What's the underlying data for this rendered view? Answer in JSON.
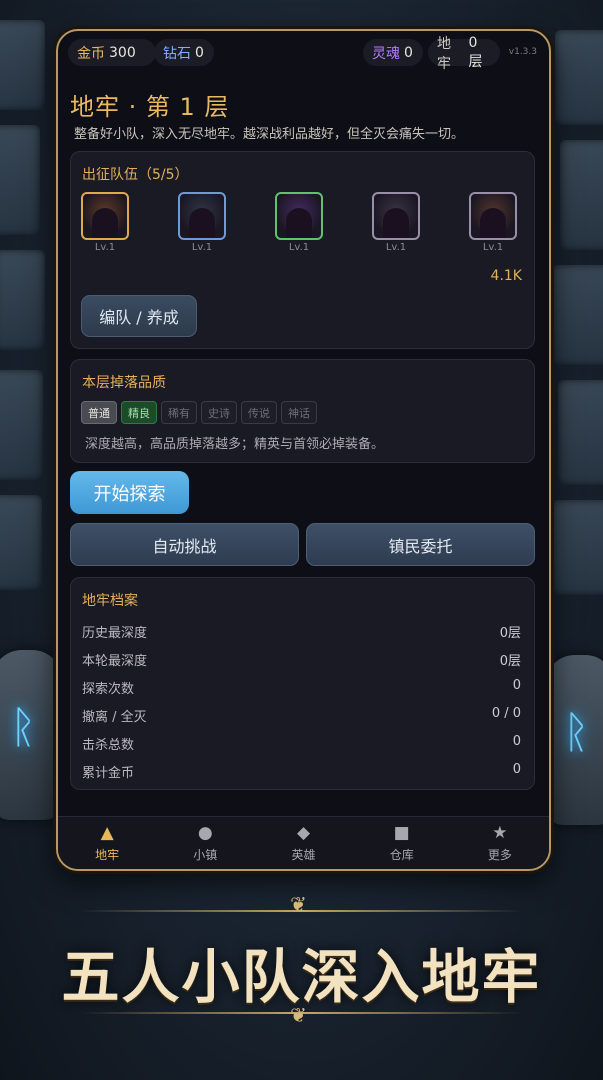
{
  "topbar": {
    "gold_label": "金币",
    "gold_value": "300",
    "diamond_label": "钻石",
    "diamond_value": "0",
    "soul_label": "灵魂",
    "soul_value": "0",
    "dungeon_label": "地牢",
    "dungeon_value": "0层",
    "version": "v1.3.3"
  },
  "header": {
    "title": "地牢 · 第 1 层",
    "subtitle": "整备好小队，深入无尽地牢。越深战利品越好，但全灭会痛失一切。"
  },
  "team": {
    "title": "出征队伍（5/5）",
    "heroes": [
      {
        "level": "Lv.1",
        "border": "#e0a94a",
        "glow": "#e07a2a"
      },
      {
        "level": "Lv.1",
        "border": "#6f9ad8",
        "glow": "#5b6a8a"
      },
      {
        "level": "Lv.1",
        "border": "#5fc36c",
        "glow": "#9b4ad8"
      },
      {
        "level": "Lv.1",
        "border": "#9a8fa8",
        "glow": "#7a6a8a"
      },
      {
        "level": "Lv.1",
        "border": "#9a8fa8",
        "glow": "#c06a3a"
      }
    ],
    "power": "4.1K",
    "team_button": "编队 / 养成"
  },
  "drops": {
    "title": "本层掉落品质",
    "qualities": [
      "普通",
      "精良",
      "稀有",
      "史诗",
      "传说",
      "神话"
    ],
    "description": "深度越高，高品质掉落越多；精英与首领必掉装备。"
  },
  "actions": {
    "explore": "开始探索",
    "auto_challenge": "自动挑战",
    "town_commission": "镇民委托"
  },
  "records": {
    "title": "地牢档案",
    "rows": [
      {
        "label": "历史最深度",
        "value": "0层"
      },
      {
        "label": "本轮最深度",
        "value": "0层"
      },
      {
        "label": "探索次数",
        "value": "0"
      },
      {
        "label": "撤离 / 全灭",
        "value": "0 / 0"
      },
      {
        "label": "击杀总数",
        "value": "0"
      },
      {
        "label": "累计金币",
        "value": "0"
      }
    ]
  },
  "nav": [
    {
      "label": "地牢",
      "icon": "▲"
    },
    {
      "label": "小镇",
      "icon": "●"
    },
    {
      "label": "英雄",
      "icon": "◆"
    },
    {
      "label": "仓库",
      "icon": "■"
    },
    {
      "label": "更多",
      "icon": "★"
    }
  ],
  "banner": {
    "text": "五人小队深入地牢",
    "ornament": "❦"
  }
}
